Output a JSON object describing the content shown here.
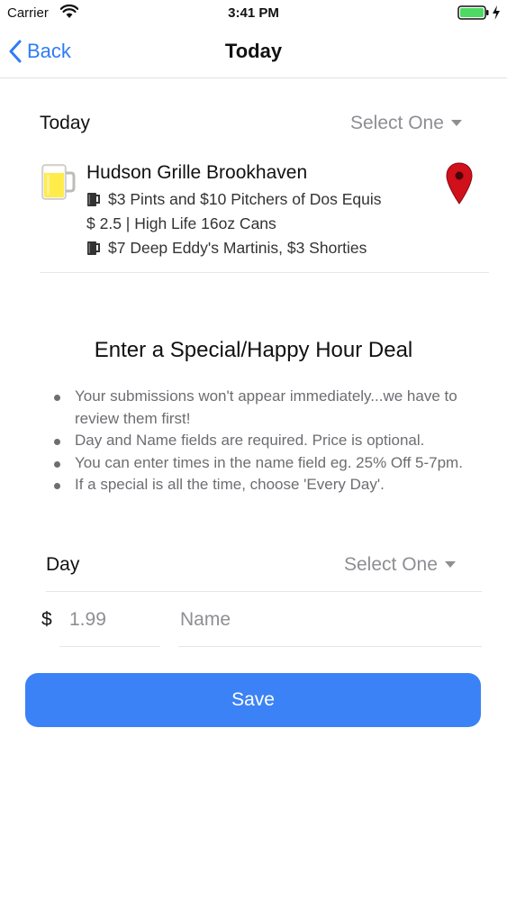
{
  "status_bar": {
    "carrier": "Carrier",
    "time": "3:41 PM"
  },
  "nav": {
    "back_label": "Back",
    "title": "Today"
  },
  "filter": {
    "label": "Today",
    "select_placeholder": "Select One"
  },
  "venue": {
    "name": "Hudson Grille Brookhaven",
    "specials": [
      "$3 Pints and $10 Pitchers of Dos Equis",
      "$ 2.5 | High Life 16oz Cans",
      "$7 Deep Eddy's Martinis, $3 Shorties"
    ]
  },
  "form": {
    "heading": "Enter a Special/Happy Hour Deal",
    "instructions": [
      "Your submissions won't appear immediately...we have to review them first!",
      "Day and Name fields are required. Price is optional.",
      "You can enter times in the name field eg. 25% Off 5-7pm.",
      "If a special is all the time, choose 'Every Day'."
    ],
    "day_label": "Day",
    "day_placeholder": "Select One",
    "currency_symbol": "$",
    "price_placeholder": "1.99",
    "name_placeholder": "Name",
    "save_label": "Save"
  },
  "colors": {
    "accent": "#2f7cf6",
    "save_button": "#3b82f6",
    "placeholder": "#8e8e93",
    "map_pin": "#d0101b",
    "battery": "#4cd964"
  }
}
